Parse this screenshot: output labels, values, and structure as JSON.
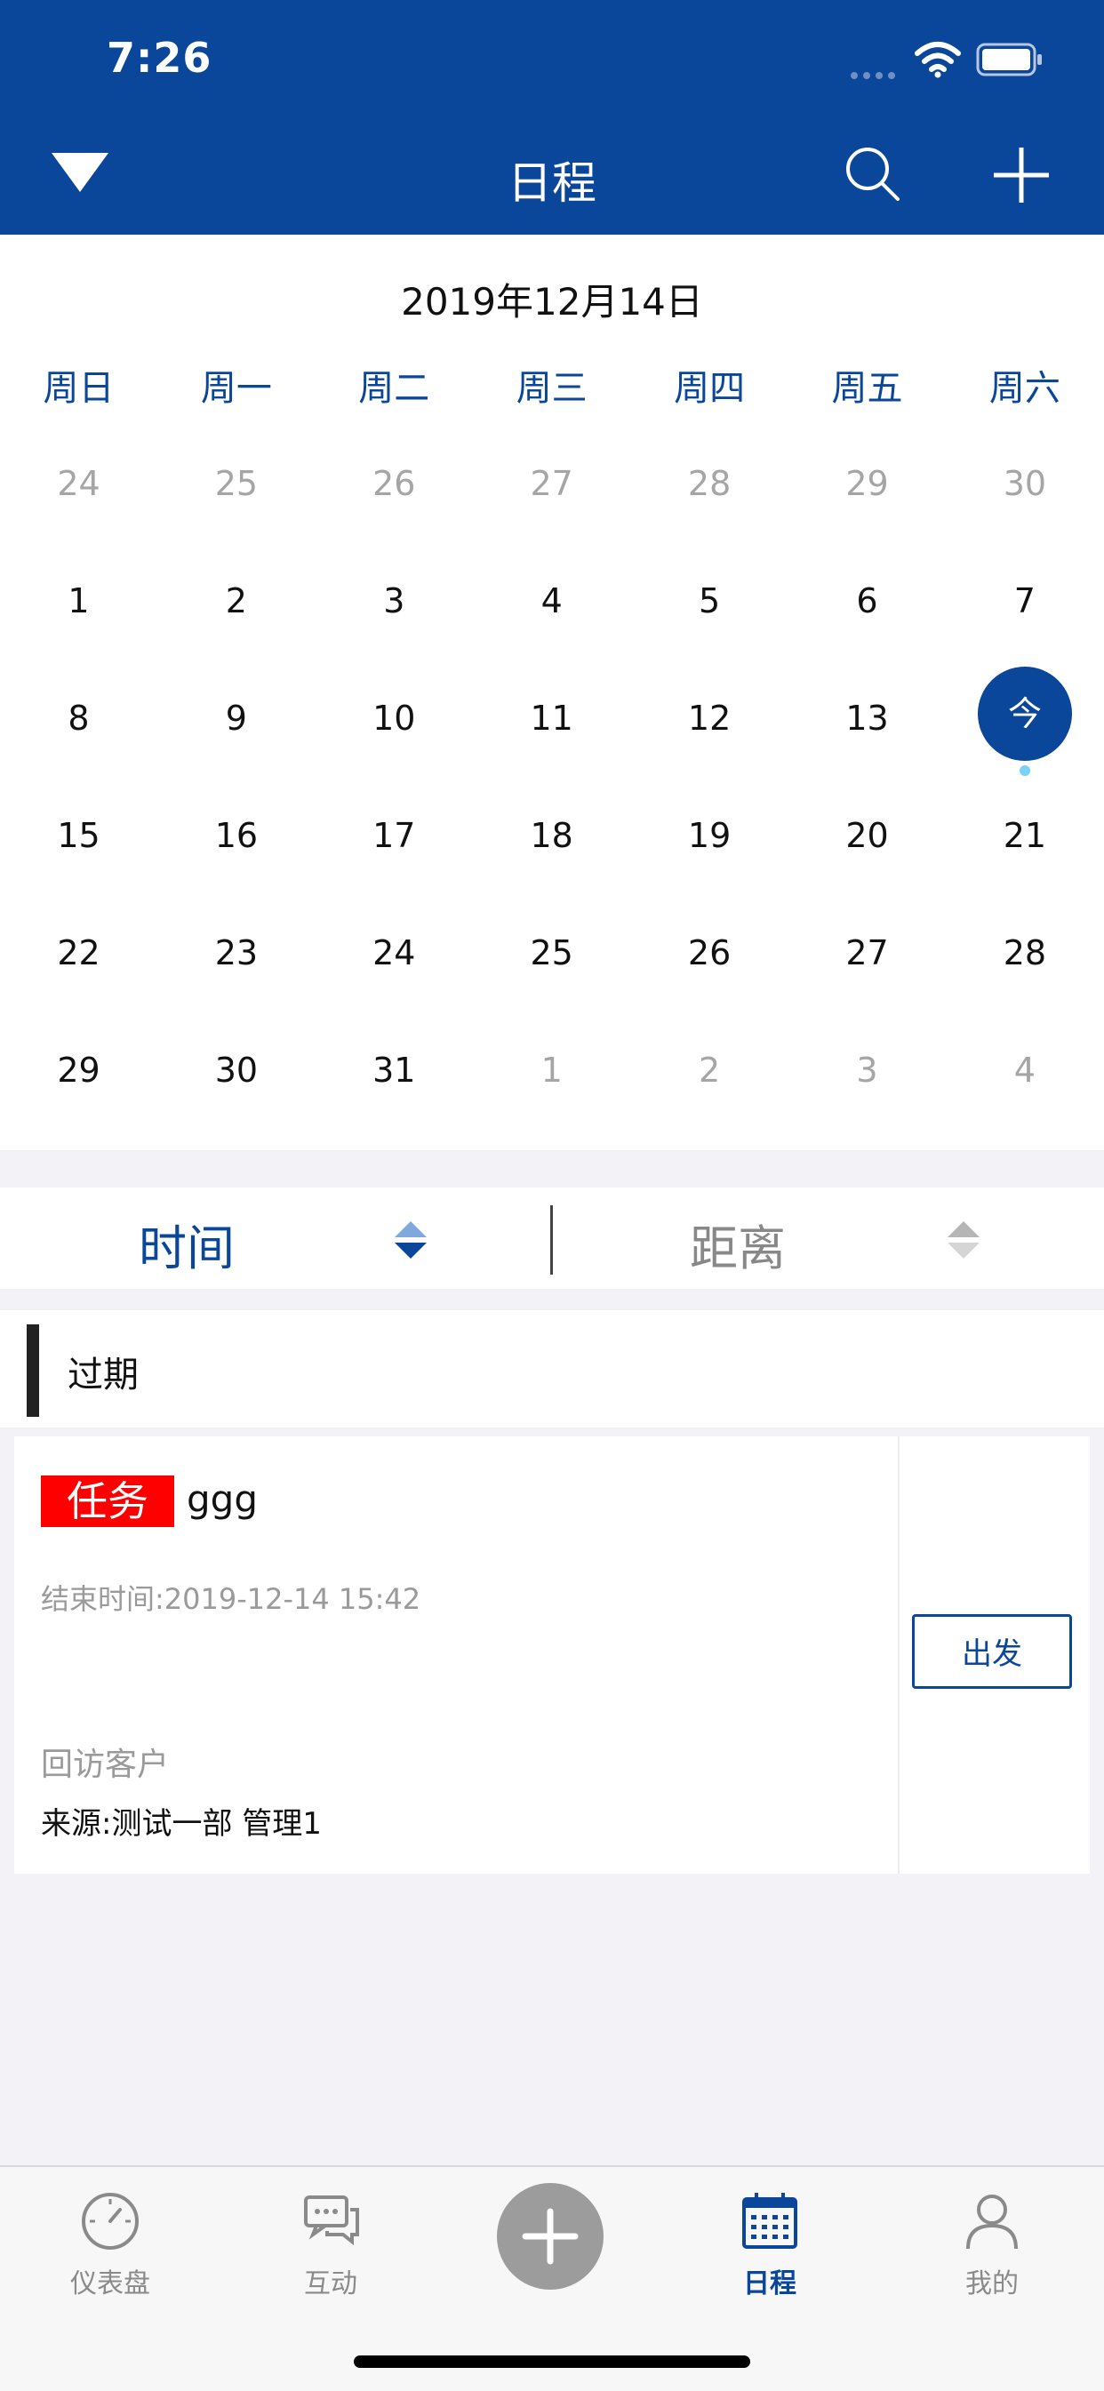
{
  "status_bar": {
    "time": "7:26"
  },
  "header": {
    "title": "日程"
  },
  "calendar": {
    "month_label": "2019年12月14日",
    "weekdays": [
      "周日",
      "周一",
      "周二",
      "周三",
      "周四",
      "周五",
      "周六"
    ],
    "weeks": [
      [
        "24",
        "25",
        "26",
        "27",
        "28",
        "29",
        "30"
      ],
      [
        "1",
        "2",
        "3",
        "4",
        "5",
        "6",
        "7"
      ],
      [
        "8",
        "9",
        "10",
        "11",
        "12",
        "13",
        "今"
      ],
      [
        "15",
        "16",
        "17",
        "18",
        "19",
        "20",
        "21"
      ],
      [
        "22",
        "23",
        "24",
        "25",
        "26",
        "27",
        "28"
      ],
      [
        "29",
        "30",
        "31",
        "1",
        "2",
        "3",
        "4"
      ]
    ],
    "today_label": "今"
  },
  "sort": {
    "time_label": "时间",
    "distance_label": "距离"
  },
  "section": {
    "title": "过期"
  },
  "task": {
    "tag": "任务",
    "name": "ggg",
    "end_time": "结束时间:2019-12-14 15:42",
    "visit": "回访客户",
    "source": "来源:测试一部 管理1",
    "depart_label": "出发"
  },
  "tabs": [
    {
      "label": "仪表盘",
      "icon": "dashboard-icon"
    },
    {
      "label": "互动",
      "icon": "chat-icon"
    },
    {
      "label": "",
      "icon": "plus-icon"
    },
    {
      "label": "日程",
      "icon": "calendar-icon",
      "active": true
    },
    {
      "label": "我的",
      "icon": "person-icon"
    }
  ],
  "colors": {
    "primary": "#0a4699",
    "tag_red": "#ff0000",
    "today_dot": "#7ad2f5"
  }
}
